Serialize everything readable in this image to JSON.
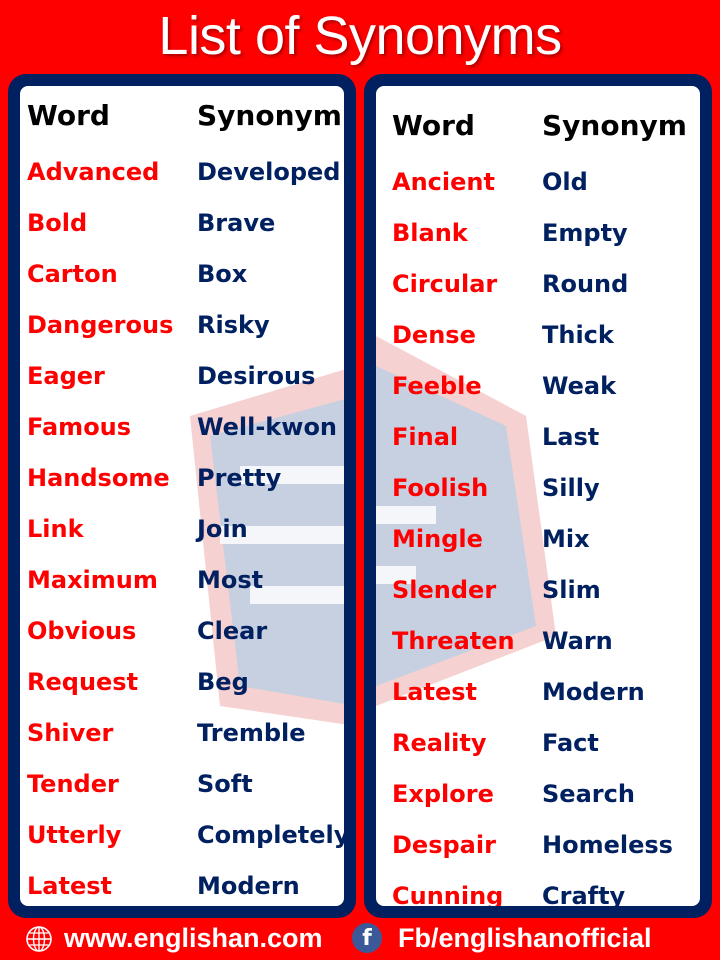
{
  "title": "List of Synonyms",
  "colors": {
    "background": "#ff0000",
    "panel_border": "#002060",
    "word_color": "#ff0000",
    "synonym_color": "#002060",
    "header_color": "#000000"
  },
  "left_table": {
    "headers": {
      "word": "Word",
      "synonym": "Synonym"
    },
    "rows": [
      {
        "word": "Advanced",
        "synonym": "Developed"
      },
      {
        "word": "Bold",
        "synonym": "Brave"
      },
      {
        "word": "Carton",
        "synonym": "Box"
      },
      {
        "word": "Dangerous",
        "synonym": "Risky"
      },
      {
        "word": "Eager",
        "synonym": "Desirous"
      },
      {
        "word": "Famous",
        "synonym": "Well-kwon"
      },
      {
        "word": "Handsome",
        "synonym": "Pretty"
      },
      {
        "word": "Link",
        "synonym": "Join"
      },
      {
        "word": "Maximum",
        "synonym": "Most"
      },
      {
        "word": "Obvious",
        "synonym": "Clear"
      },
      {
        "word": "Request",
        "synonym": "Beg"
      },
      {
        "word": "Shiver",
        "synonym": "Tremble"
      },
      {
        "word": "Tender",
        "synonym": "Soft"
      },
      {
        "word": "Utterly",
        "synonym": "Completely"
      },
      {
        "word": "Latest",
        "synonym": "Modern"
      }
    ]
  },
  "right_table": {
    "headers": {
      "word": "Word",
      "synonym": "Synonym"
    },
    "rows": [
      {
        "word": "Ancient",
        "synonym": "Old"
      },
      {
        "word": "Blank",
        "synonym": "Empty"
      },
      {
        "word": "Circular",
        "synonym": "Round"
      },
      {
        "word": "Dense",
        "synonym": "Thick"
      },
      {
        "word": "Feeble",
        "synonym": "Weak"
      },
      {
        "word": "Final",
        "synonym": "Last"
      },
      {
        "word": "Foolish",
        "synonym": "Silly"
      },
      {
        "word": "Mingle",
        "synonym": "Mix"
      },
      {
        "word": "Slender",
        "synonym": "Slim"
      },
      {
        "word": "Threaten",
        "synonym": "Warn"
      },
      {
        "word": "Latest",
        "synonym": "Modern"
      },
      {
        "word": "Reality",
        "synonym": "Fact"
      },
      {
        "word": "Explore",
        "synonym": "Search"
      },
      {
        "word": "Despair",
        "synonym": "Homeless"
      },
      {
        "word": "Cunning",
        "synonym": "Crafty"
      }
    ]
  },
  "watermark": "www.englishan.com",
  "footer": {
    "website_icon": "globe-icon",
    "website": "www.englishan.com",
    "social_icon": "facebook-icon",
    "social_glyph": "f",
    "social": "Fb/englishanofficial"
  }
}
